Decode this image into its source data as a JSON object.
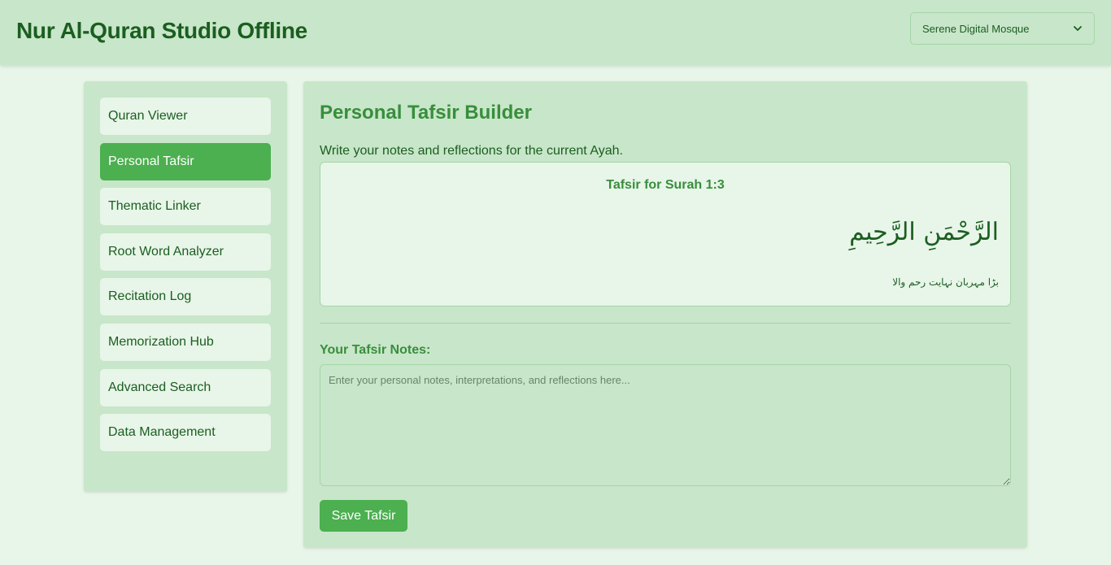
{
  "app": {
    "title": "Nur Al-Quran Studio Offline"
  },
  "theme_select": {
    "selected": "Serene Digital Mosque"
  },
  "sidebar": {
    "items": [
      {
        "label": "Quran Viewer"
      },
      {
        "label": "Personal Tafsir",
        "active": true
      },
      {
        "label": "Thematic Linker"
      },
      {
        "label": "Root Word Analyzer"
      },
      {
        "label": "Recitation Log"
      },
      {
        "label": "Memorization Hub"
      },
      {
        "label": "Advanced Search"
      },
      {
        "label": "Data Management"
      }
    ]
  },
  "main": {
    "title": "Personal Tafsir Builder",
    "description": "Write your notes and reflections for the current Ayah.",
    "ayah": {
      "heading": "Tafsir for Surah 1:3",
      "arabic": "الرَّحْمَنِ الرَّحِيمِ",
      "translation": "بڑا مہربان نہایت رحم والا"
    },
    "notes": {
      "label": "Your Tafsir Notes:",
      "placeholder": "Enter your personal notes, interpretations, and reflections here...",
      "value": ""
    },
    "save_label": "Save Tafsir"
  },
  "colors": {
    "header_bg": "#c8e6c9",
    "page_bg": "#e8f5e9",
    "accent": "#4caf50",
    "title_text": "#1b5e20",
    "heading_text": "#388e3c"
  },
  "icons": {
    "select_arrow": "chevron-down-icon"
  }
}
